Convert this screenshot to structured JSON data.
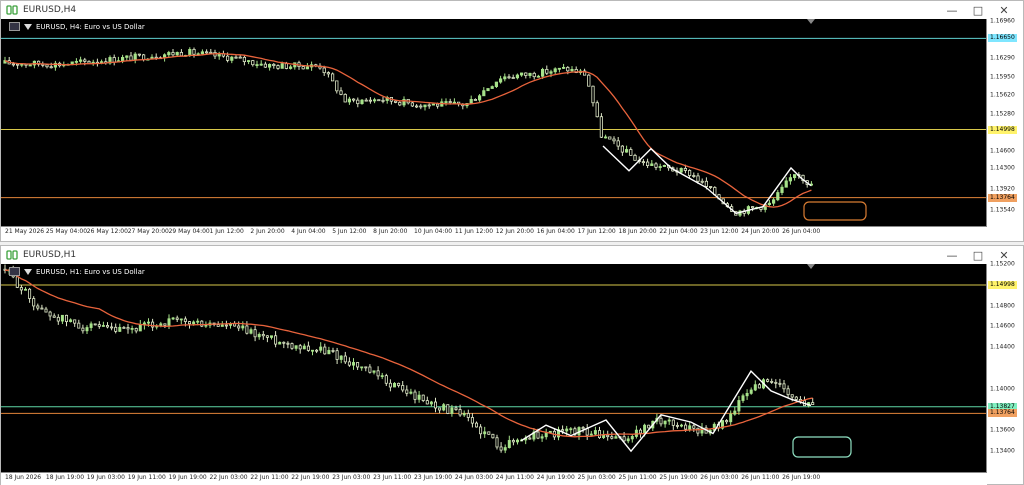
{
  "colors": {
    "bull_candle": "#a7e28a",
    "bear_candle": "#dfe8c8",
    "ma_line": "#e8633c",
    "zigzag": "#ffffff",
    "yellow_line": "#d8c84a",
    "cyan_line": "#5fd0d0",
    "orange_line": "#e2853a",
    "green_line": "#5fd6a6",
    "box_orange": "#d87c32",
    "box_green": "#8fe0c2"
  },
  "window_buttons": {
    "minimize": "—",
    "maximize": "□",
    "close": "✕"
  },
  "top": {
    "title": "EURUSD,H4",
    "header": "EURUSD, H4:  Euro vs US Dollar",
    "price_min": 1.1325,
    "price_max": 1.17,
    "price_ticks": [
      "1.16960",
      "1.16290",
      "1.15950",
      "1.15620",
      "1.15280",
      "1.14600",
      "1.14300",
      "1.13920",
      "1.13540"
    ],
    "price_tick_values": [
      1.1696,
      1.1629,
      1.1595,
      1.1562,
      1.1528,
      1.146,
      1.143,
      1.1392,
      1.1354
    ],
    "hlines": [
      {
        "label": "1.16650",
        "value": 1.1665,
        "kind": "cyan"
      },
      {
        "label": "1.14998",
        "value": 1.14998,
        "kind": "yellow"
      },
      {
        "label": "1.13764",
        "value": 1.13764,
        "kind": "orange"
      }
    ],
    "time_labels": [
      "21 May 2026",
      "25 May 04:00",
      "26 May 12:00",
      "27 May 20:00",
      "29 May 04:00",
      "1 Jun 12:00",
      "2 Jun 20:00",
      "4 Jun 04:00",
      "5 Jun 12:00",
      "8 Jun 20:00",
      "10 Jun 04:00",
      "11 Jun 12:00",
      "12 Jun 20:00",
      "16 Jun 04:00",
      "17 Jun 12:00",
      "18 Jun 20:00",
      "22 Jun 04:00",
      "23 Jun 12:00",
      "24 Jun 20:00",
      "26 Jun 04:00"
    ]
  },
  "bottom": {
    "title": "EURUSD,H1",
    "header": "EURUSD, H1:  Euro vs US Dollar",
    "price_min": 1.132,
    "price_max": 1.152,
    "price_ticks": [
      "1.15200",
      "1.14800",
      "1.14600",
      "1.14400",
      "1.14000",
      "1.13600",
      "1.13400"
    ],
    "price_tick_values": [
      1.152,
      1.148,
      1.146,
      1.144,
      1.14,
      1.136,
      1.134
    ],
    "hlines": [
      {
        "label": "1.14998",
        "value": 1.14998,
        "kind": "yellow"
      },
      {
        "label": "1.13827",
        "value": 1.13827,
        "kind": "green"
      },
      {
        "label": "1.13764",
        "value": 1.13764,
        "kind": "orange"
      }
    ],
    "time_labels": [
      "18 Jun 2026",
      "18 Jun 19:00",
      "19 Jun 03:00",
      "19 Jun 11:00",
      "19 Jun 19:00",
      "22 Jun 03:00",
      "22 Jun 11:00",
      "22 Jun 19:00",
      "23 Jun 03:00",
      "23 Jun 11:00",
      "23 Jun 19:00",
      "24 Jun 03:00",
      "24 Jun 11:00",
      "24 Jun 19:00",
      "25 Jun 03:00",
      "25 Jun 11:00",
      "25 Jun 19:00",
      "26 Jun 03:00",
      "26 Jun 11:00",
      "26 Jun 19:00"
    ]
  }
}
